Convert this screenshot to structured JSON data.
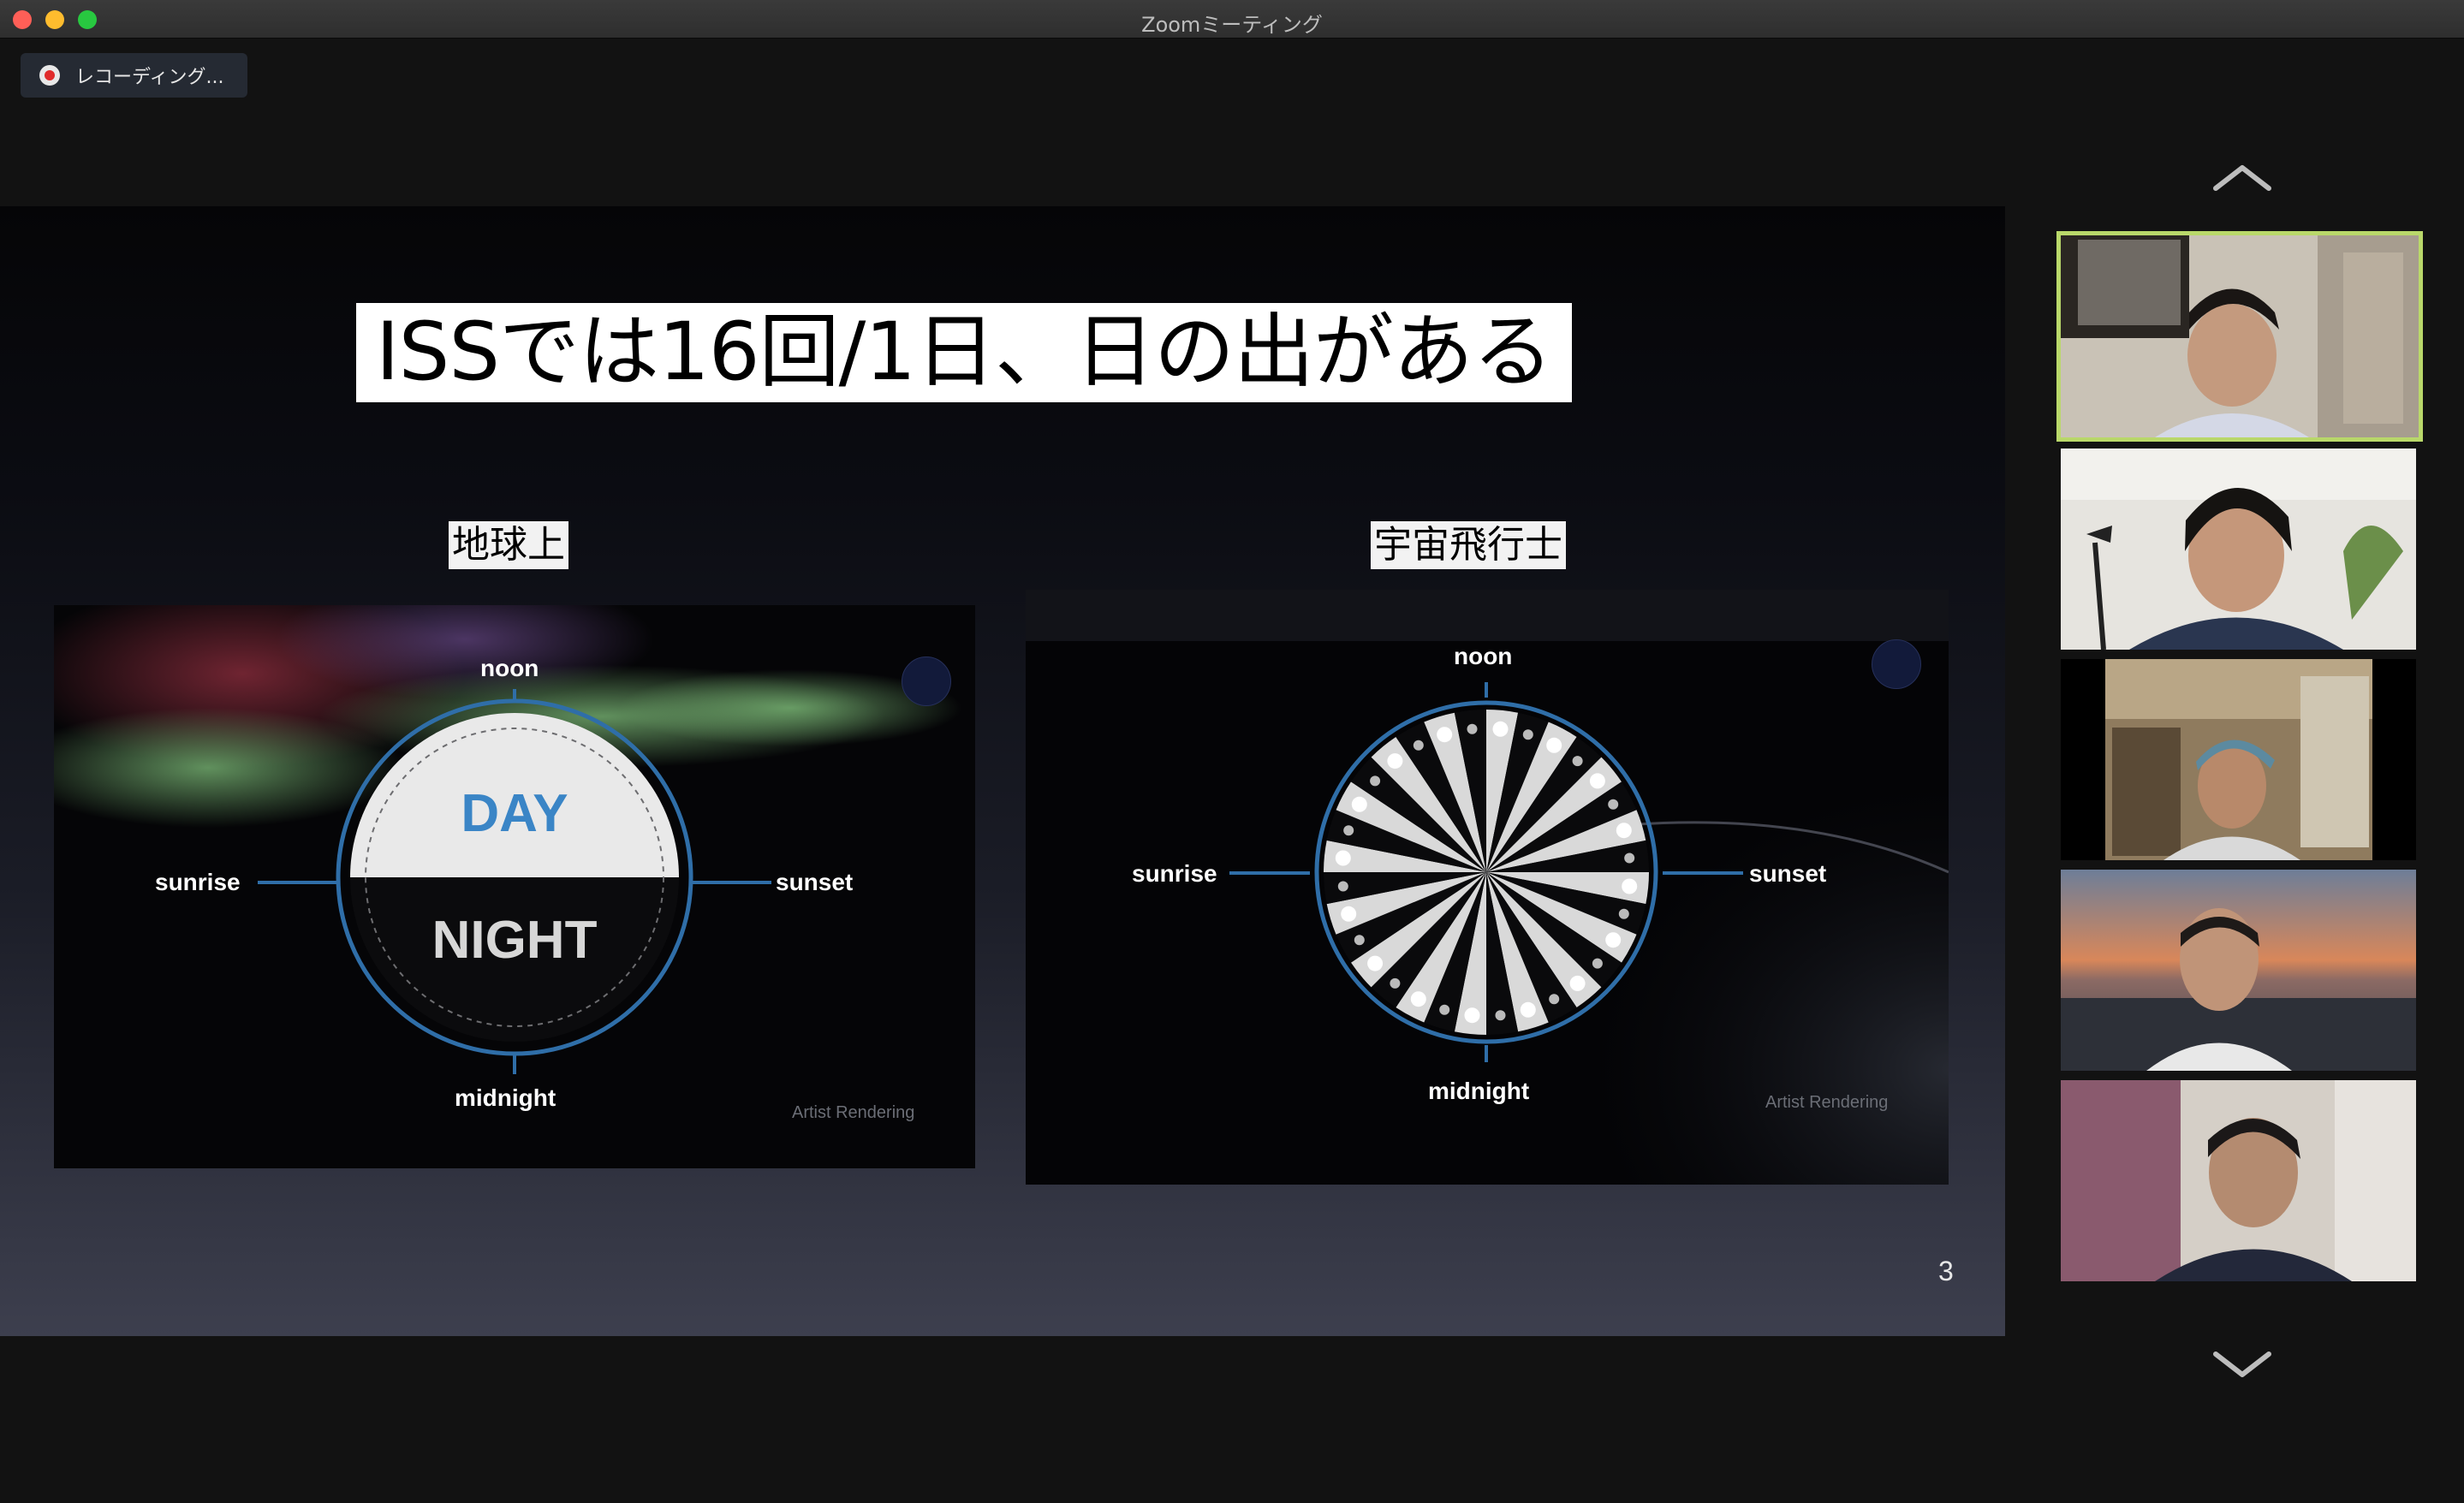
{
  "window": {
    "title": "Zoomミーティング"
  },
  "recording": {
    "label": "レコーディング..."
  },
  "slide": {
    "title": "ISSでは16回/1日、日の出がある",
    "page_number": "3",
    "left": {
      "caption": "地球上",
      "noon": "noon",
      "sunrise": "sunrise",
      "sunset": "sunset",
      "midnight": "midnight",
      "day": "DAY",
      "night": "NIGHT",
      "watermark": "Artist Rendering"
    },
    "right": {
      "caption": "宇宙飛行士",
      "noon": "noon",
      "sunrise": "sunrise",
      "sunset": "sunset",
      "midnight": "midnight",
      "watermark": "Artist Rendering"
    }
  },
  "gallery": {
    "scroll_up_icon": "chevron-up-icon",
    "scroll_down_icon": "chevron-down-icon",
    "participants": [
      {
        "id": "participant-1",
        "active_speaker": true
      },
      {
        "id": "participant-2",
        "active_speaker": false
      },
      {
        "id": "participant-3",
        "active_speaker": false
      },
      {
        "id": "participant-4",
        "active_speaker": false
      },
      {
        "id": "participant-5",
        "active_speaker": false
      }
    ]
  },
  "colors": {
    "active_speaker_border": "#b9d86a",
    "recording_dot": "#e02b2b",
    "day_text": "#3a85c6"
  }
}
